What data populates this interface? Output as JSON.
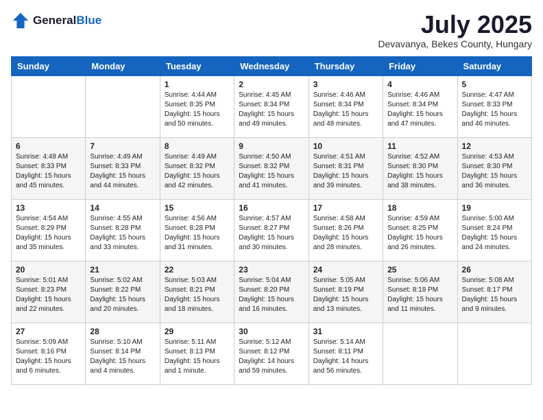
{
  "logo": {
    "general": "General",
    "blue": "Blue"
  },
  "title": "July 2025",
  "subtitle": "Devavanya, Bekes County, Hungary",
  "weekdays": [
    "Sunday",
    "Monday",
    "Tuesday",
    "Wednesday",
    "Thursday",
    "Friday",
    "Saturday"
  ],
  "weeks": [
    [
      {
        "day": "",
        "sunrise": "",
        "sunset": "",
        "daylight": ""
      },
      {
        "day": "",
        "sunrise": "",
        "sunset": "",
        "daylight": ""
      },
      {
        "day": "1",
        "sunrise": "Sunrise: 4:44 AM",
        "sunset": "Sunset: 8:35 PM",
        "daylight": "Daylight: 15 hours and 50 minutes."
      },
      {
        "day": "2",
        "sunrise": "Sunrise: 4:45 AM",
        "sunset": "Sunset: 8:34 PM",
        "daylight": "Daylight: 15 hours and 49 minutes."
      },
      {
        "day": "3",
        "sunrise": "Sunrise: 4:46 AM",
        "sunset": "Sunset: 8:34 PM",
        "daylight": "Daylight: 15 hours and 48 minutes."
      },
      {
        "day": "4",
        "sunrise": "Sunrise: 4:46 AM",
        "sunset": "Sunset: 8:34 PM",
        "daylight": "Daylight: 15 hours and 47 minutes."
      },
      {
        "day": "5",
        "sunrise": "Sunrise: 4:47 AM",
        "sunset": "Sunset: 8:33 PM",
        "daylight": "Daylight: 15 hours and 46 minutes."
      }
    ],
    [
      {
        "day": "6",
        "sunrise": "Sunrise: 4:48 AM",
        "sunset": "Sunset: 8:33 PM",
        "daylight": "Daylight: 15 hours and 45 minutes."
      },
      {
        "day": "7",
        "sunrise": "Sunrise: 4:49 AM",
        "sunset": "Sunset: 8:33 PM",
        "daylight": "Daylight: 15 hours and 44 minutes."
      },
      {
        "day": "8",
        "sunrise": "Sunrise: 4:49 AM",
        "sunset": "Sunset: 8:32 PM",
        "daylight": "Daylight: 15 hours and 42 minutes."
      },
      {
        "day": "9",
        "sunrise": "Sunrise: 4:50 AM",
        "sunset": "Sunset: 8:32 PM",
        "daylight": "Daylight: 15 hours and 41 minutes."
      },
      {
        "day": "10",
        "sunrise": "Sunrise: 4:51 AM",
        "sunset": "Sunset: 8:31 PM",
        "daylight": "Daylight: 15 hours and 39 minutes."
      },
      {
        "day": "11",
        "sunrise": "Sunrise: 4:52 AM",
        "sunset": "Sunset: 8:30 PM",
        "daylight": "Daylight: 15 hours and 38 minutes."
      },
      {
        "day": "12",
        "sunrise": "Sunrise: 4:53 AM",
        "sunset": "Sunset: 8:30 PM",
        "daylight": "Daylight: 15 hours and 36 minutes."
      }
    ],
    [
      {
        "day": "13",
        "sunrise": "Sunrise: 4:54 AM",
        "sunset": "Sunset: 8:29 PM",
        "daylight": "Daylight: 15 hours and 35 minutes."
      },
      {
        "day": "14",
        "sunrise": "Sunrise: 4:55 AM",
        "sunset": "Sunset: 8:28 PM",
        "daylight": "Daylight: 15 hours and 33 minutes."
      },
      {
        "day": "15",
        "sunrise": "Sunrise: 4:56 AM",
        "sunset": "Sunset: 8:28 PM",
        "daylight": "Daylight: 15 hours and 31 minutes."
      },
      {
        "day": "16",
        "sunrise": "Sunrise: 4:57 AM",
        "sunset": "Sunset: 8:27 PM",
        "daylight": "Daylight: 15 hours and 30 minutes."
      },
      {
        "day": "17",
        "sunrise": "Sunrise: 4:58 AM",
        "sunset": "Sunset: 8:26 PM",
        "daylight": "Daylight: 15 hours and 28 minutes."
      },
      {
        "day": "18",
        "sunrise": "Sunrise: 4:59 AM",
        "sunset": "Sunset: 8:25 PM",
        "daylight": "Daylight: 15 hours and 26 minutes."
      },
      {
        "day": "19",
        "sunrise": "Sunrise: 5:00 AM",
        "sunset": "Sunset: 8:24 PM",
        "daylight": "Daylight: 15 hours and 24 minutes."
      }
    ],
    [
      {
        "day": "20",
        "sunrise": "Sunrise: 5:01 AM",
        "sunset": "Sunset: 8:23 PM",
        "daylight": "Daylight: 15 hours and 22 minutes."
      },
      {
        "day": "21",
        "sunrise": "Sunrise: 5:02 AM",
        "sunset": "Sunset: 8:22 PM",
        "daylight": "Daylight: 15 hours and 20 minutes."
      },
      {
        "day": "22",
        "sunrise": "Sunrise: 5:03 AM",
        "sunset": "Sunset: 8:21 PM",
        "daylight": "Daylight: 15 hours and 18 minutes."
      },
      {
        "day": "23",
        "sunrise": "Sunrise: 5:04 AM",
        "sunset": "Sunset: 8:20 PM",
        "daylight": "Daylight: 15 hours and 16 minutes."
      },
      {
        "day": "24",
        "sunrise": "Sunrise: 5:05 AM",
        "sunset": "Sunset: 8:19 PM",
        "daylight": "Daylight: 15 hours and 13 minutes."
      },
      {
        "day": "25",
        "sunrise": "Sunrise: 5:06 AM",
        "sunset": "Sunset: 8:18 PM",
        "daylight": "Daylight: 15 hours and 11 minutes."
      },
      {
        "day": "26",
        "sunrise": "Sunrise: 5:08 AM",
        "sunset": "Sunset: 8:17 PM",
        "daylight": "Daylight: 15 hours and 9 minutes."
      }
    ],
    [
      {
        "day": "27",
        "sunrise": "Sunrise: 5:09 AM",
        "sunset": "Sunset: 8:16 PM",
        "daylight": "Daylight: 15 hours and 6 minutes."
      },
      {
        "day": "28",
        "sunrise": "Sunrise: 5:10 AM",
        "sunset": "Sunset: 8:14 PM",
        "daylight": "Daylight: 15 hours and 4 minutes."
      },
      {
        "day": "29",
        "sunrise": "Sunrise: 5:11 AM",
        "sunset": "Sunset: 8:13 PM",
        "daylight": "Daylight: 15 hours and 1 minute."
      },
      {
        "day": "30",
        "sunrise": "Sunrise: 5:12 AM",
        "sunset": "Sunset: 8:12 PM",
        "daylight": "Daylight: 14 hours and 59 minutes."
      },
      {
        "day": "31",
        "sunrise": "Sunrise: 5:14 AM",
        "sunset": "Sunset: 8:11 PM",
        "daylight": "Daylight: 14 hours and 56 minutes."
      },
      {
        "day": "",
        "sunrise": "",
        "sunset": "",
        "daylight": ""
      },
      {
        "day": "",
        "sunrise": "",
        "sunset": "",
        "daylight": ""
      }
    ]
  ]
}
